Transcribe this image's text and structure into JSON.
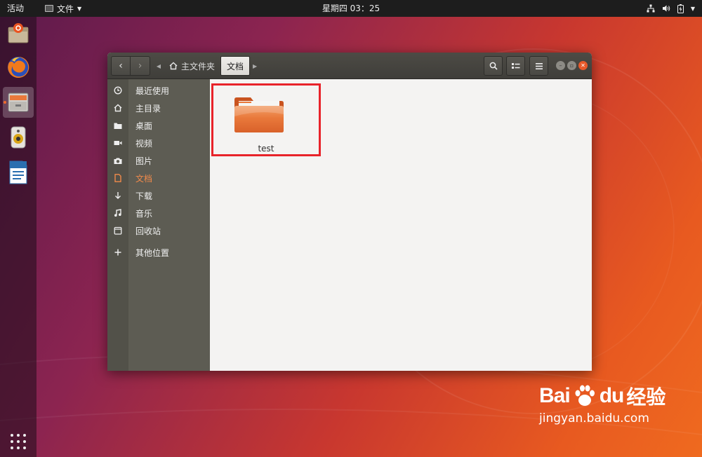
{
  "topbar": {
    "activities": "活动",
    "app_menu": "文件",
    "clock": "星期四 03：25"
  },
  "dock": {
    "items": [
      {
        "name": "software-installer",
        "icon": "package-icon"
      },
      {
        "name": "firefox",
        "icon": "firefox-icon"
      },
      {
        "name": "files",
        "icon": "file-cabinet-icon",
        "active": true
      },
      {
        "name": "rhythmbox",
        "icon": "speaker-icon"
      },
      {
        "name": "libreoffice-writer",
        "icon": "document-icon"
      }
    ]
  },
  "window": {
    "path": {
      "home": "主文件夹",
      "current": "文档"
    },
    "sidebar": {
      "items": [
        {
          "label": "最近使用",
          "icon": "clock-icon"
        },
        {
          "label": "主目录",
          "icon": "home-icon"
        },
        {
          "label": "桌面",
          "icon": "folder-icon"
        },
        {
          "label": "视频",
          "icon": "video-icon"
        },
        {
          "label": "图片",
          "icon": "camera-icon"
        },
        {
          "label": "文档",
          "icon": "document-icon",
          "active": true
        },
        {
          "label": "下载",
          "icon": "download-icon"
        },
        {
          "label": "音乐",
          "icon": "music-icon"
        },
        {
          "label": "回收站",
          "icon": "trash-icon"
        },
        {
          "label": "其他位置",
          "icon": "plus-icon"
        }
      ]
    },
    "files": [
      {
        "name": "test",
        "type": "folder",
        "highlight_color": "#e8232a"
      }
    ]
  },
  "watermark": {
    "logo": "Bai",
    "logo_end": "du",
    "cn": "经验",
    "url": "jingyan.baidu.com"
  },
  "colors": {
    "accent": "#f06a2c",
    "highlight": "#e8232a"
  }
}
